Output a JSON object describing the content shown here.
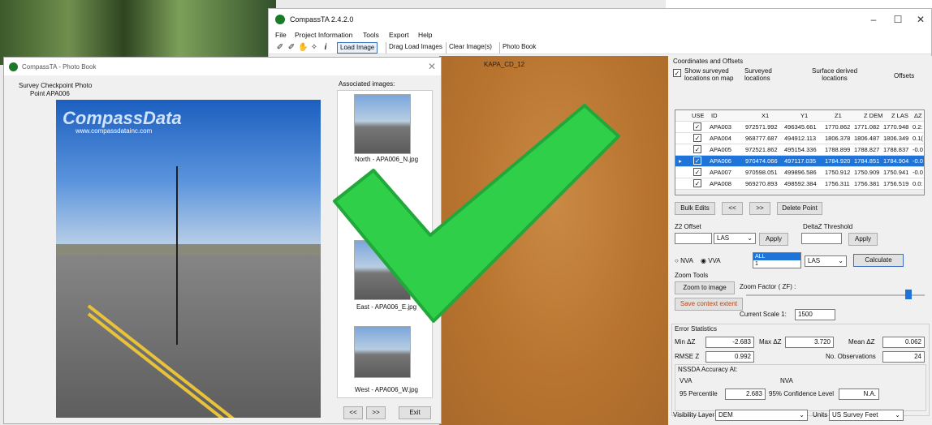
{
  "main_window": {
    "title": "CompassTA 2.4.2.0",
    "menu": [
      "File",
      "Project Information",
      "Tools",
      "Export",
      "Help"
    ],
    "toolbar": {
      "load_image": "Load Image",
      "drag_load_images": "Drag Load Images",
      "clear_images": "Clear Image(s)",
      "photo_book": "Photo Book"
    },
    "map_label": "KAPA_CD_12"
  },
  "photo_book": {
    "title": "CompassTA - Photo Book",
    "caption": "Survey Checkpoint Photo",
    "point": "Point APA006",
    "assoc_label": "Associated images:",
    "brand": "CompassData",
    "brand_url": "www.compassdatainc.com",
    "thumbs": [
      "North - APA006_N.jpg",
      "East - APA006_E.jpg",
      "West - APA006_W.jpg"
    ],
    "prev": "<<",
    "next": ">>",
    "exit": "Exit"
  },
  "panel": {
    "header": "Coordinates and Offsets",
    "show_surveyed": "Show surveyed locations on map",
    "col_group_surveyed": "Surveyed locations",
    "col_group_surface": "Surface derived locations",
    "col_group_offsets": "Offsets",
    "columns": [
      "USE",
      "ID",
      "X1",
      "Y1",
      "Z1",
      "Z DEM",
      "Z LAS",
      "ΔZ D"
    ],
    "rows": [
      {
        "id": "APA003",
        "x1": "972571.992",
        "y1": "496345.661",
        "z1": "1770.862",
        "zdem": "1771.082",
        "zlas": "1770.948",
        "dz": "0.2:"
      },
      {
        "id": "APA004",
        "x1": "968777.687",
        "y1": "494912.113",
        "z1": "1806.378",
        "zdem": "1806.487",
        "zlas": "1806.349",
        "dz": "0.1("
      },
      {
        "id": "APA005",
        "x1": "972521.862",
        "y1": "495154.336",
        "z1": "1788.899",
        "zdem": "1788.827",
        "zlas": "1788.837",
        "dz": "-0.0"
      },
      {
        "id": "APA006",
        "x1": "970474.066",
        "y1": "497117.035",
        "z1": "1784.920",
        "zdem": "1784.851",
        "zlas": "1784.904",
        "dz": "-0.0"
      },
      {
        "id": "APA007",
        "x1": "970598.051",
        "y1": "499896.586",
        "z1": "1750.912",
        "zdem": "1750.909",
        "zlas": "1750.941",
        "dz": "-0.0"
      },
      {
        "id": "APA008",
        "x1": "969270.893",
        "y1": "498592.384",
        "z1": "1756.311",
        "zdem": "1756.381",
        "zlas": "1756.519",
        "dz": "0.0:"
      }
    ],
    "bulk_edits": "Bulk Edits",
    "prev": "<<",
    "next": ">>",
    "delete_point": "Delete Point",
    "z2_offset": "Z2 Offset",
    "las": "LAS",
    "apply": "Apply",
    "deltaz_threshold": "DeltaZ Threshold",
    "nva": "NVA",
    "vva": "VVA",
    "list_all": "ALL",
    "list_one": "1",
    "calculate": "Calculate",
    "zoom_tools": "Zoom Tools",
    "zoom_to_image": "Zoom to image",
    "zoom_factor": "Zoom Factor ( ZF) :",
    "save_context": "Save context extent",
    "current_scale_label": "Current Scale  1:",
    "current_scale": "1500",
    "error_stats": "Error Statistics",
    "min_dz_label": "Min ΔZ",
    "min_dz": "-2.683",
    "max_dz_label": "Max ΔZ",
    "max_dz": "3.720",
    "mean_dz_label": "Mean ΔZ",
    "mean_dz": "0.062",
    "rmse_label": "RMSE Z",
    "rmse": "0.992",
    "obs_label": "No. Observations",
    "obs": "24",
    "nssda": "NSSDA Accuracy At:",
    "vva_label": "VVA",
    "nva_label": "NVA",
    "pct95_label": "95 Percentile",
    "pct95": "2.683",
    "conf_label": "95% Confidence Level",
    "conf": "N.A.",
    "vis_layer_label": "Visibility Layer",
    "vis_layer": "DEM",
    "units_label": "Units",
    "units": "US Survey Feet"
  },
  "overlay": {
    "check_color": "#2fcf4a"
  }
}
